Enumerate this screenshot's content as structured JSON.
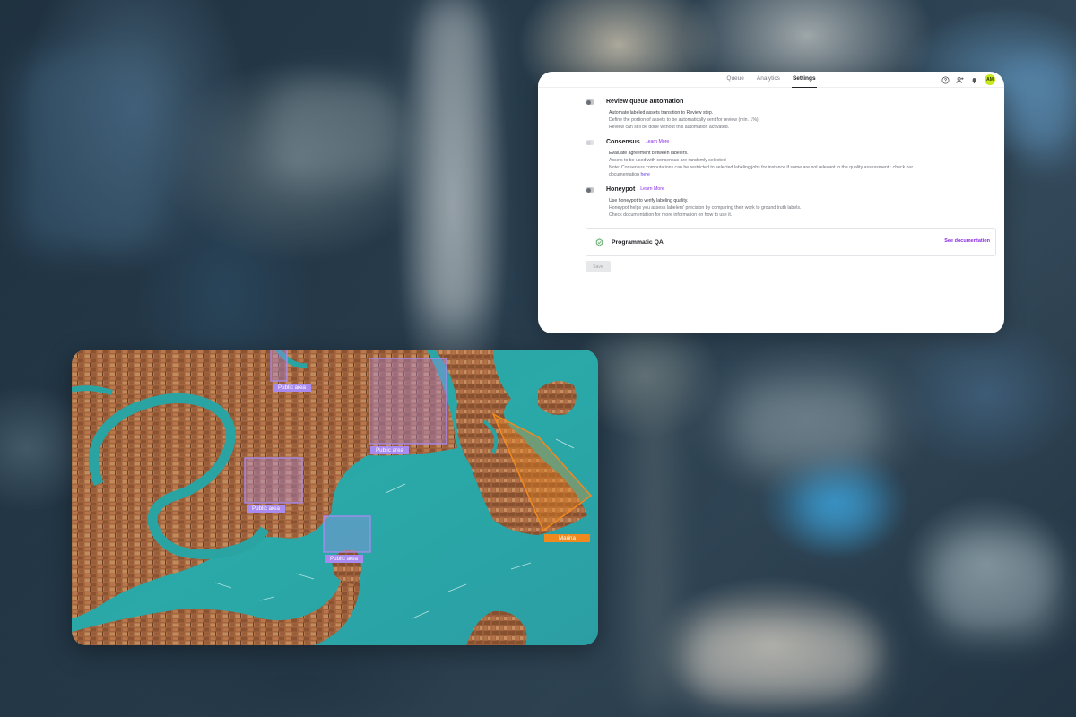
{
  "colors": {
    "accent": "#8a2be2",
    "avatar_bg": "#c7e81a",
    "public_area": "#a98bf0",
    "marina": "#f08a1e",
    "water": "#2aa7a5"
  },
  "nav": {
    "tabs": [
      {
        "label": "Queue",
        "active": false
      },
      {
        "label": "Analytics",
        "active": false
      },
      {
        "label": "Settings",
        "active": true
      }
    ],
    "icons": [
      "help-icon",
      "add-user-icon",
      "bell-icon"
    ],
    "avatar": "AM"
  },
  "settings": {
    "review": {
      "title": "Review queue automation",
      "lines": [
        "Automate labeled assets transition to Review step.",
        "Define the portion of assets to be automatically sent for review (min. 1%).",
        "Review can still be done without this automation activated."
      ]
    },
    "consensus": {
      "title": "Consensus",
      "learn_more": "Learn More",
      "lines": [
        "Evaluate agreement between labelers.",
        "Assets to be used with consensus are randomly selected",
        "Note: Consensus computations can be restricted to selected labeling jobs for instance if some are not relevant in the quality assessment : check our"
      ],
      "doc_prefix": "documentation ",
      "doc_link": "here"
    },
    "honeypot": {
      "title": "Honeypot",
      "learn_more": "Learn More",
      "lines": [
        "Use honeypot to verify labeling quality.",
        "Honeypot helps you assess labelers' precision by comparing their work to ground truth labels.",
        "Check documentation for more information on how to use it."
      ]
    },
    "programmatic_qa": {
      "title": "Programmatic QA",
      "link": "See documentation"
    },
    "save_label": "Save"
  },
  "map": {
    "labels": {
      "public_area_1": "Public area",
      "public_area_2": "Public area",
      "public_area_3": "Public area",
      "public_area_4": "Public area",
      "marina": "Marina"
    }
  }
}
